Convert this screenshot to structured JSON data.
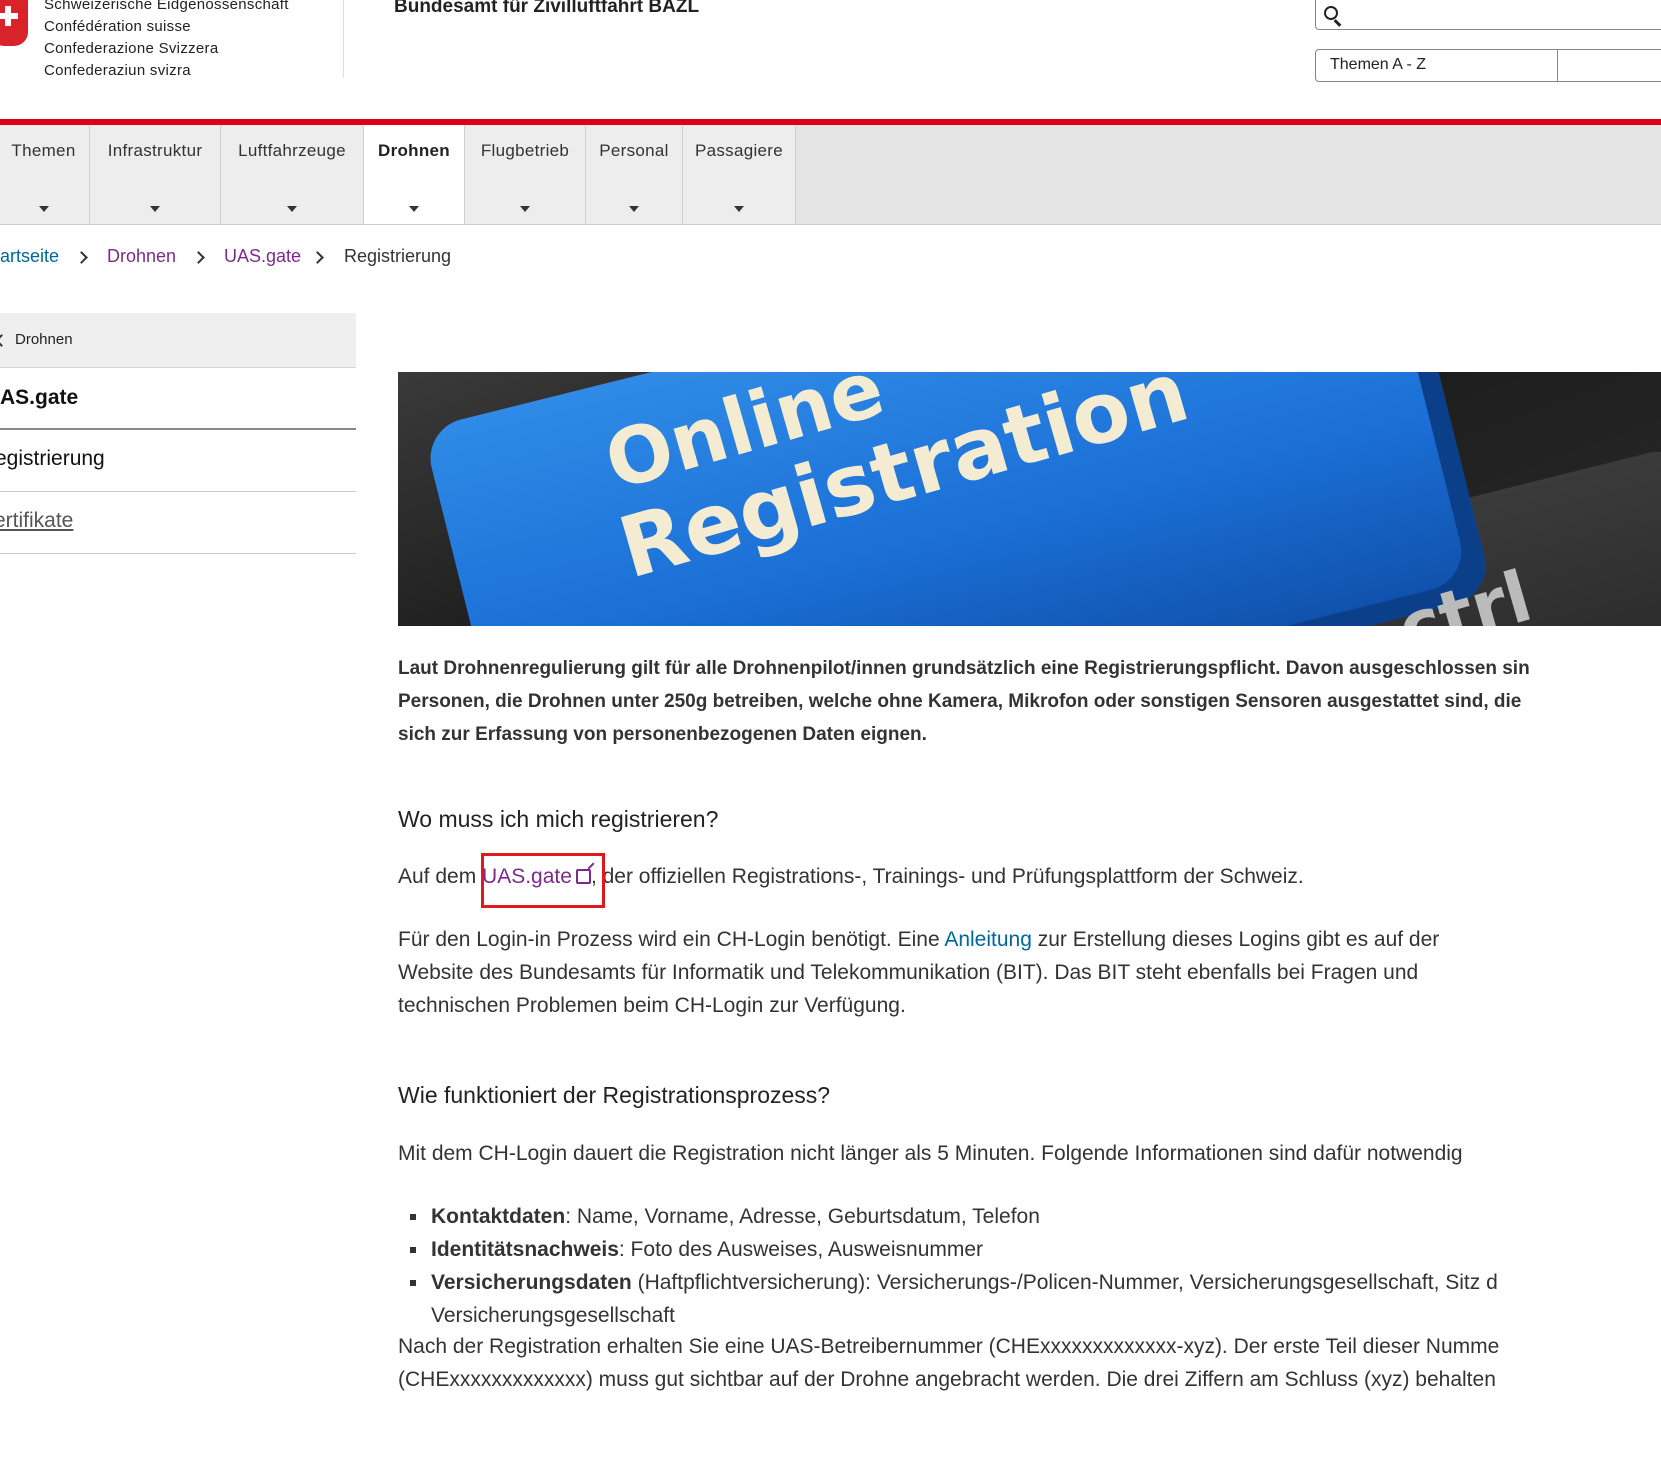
{
  "header": {
    "confederation_names": [
      "Schweizerische Eidgenossenschaft",
      "Confédération suisse",
      "Confederazione Svizzera",
      "Confederaziun svizra"
    ],
    "office_title": "Bundesamt für Zivilluftfahrt BAZL",
    "search": {
      "placeholder": ""
    },
    "themen_az": "Themen A - Z"
  },
  "nav": {
    "items": [
      {
        "label": "Themen",
        "active": false
      },
      {
        "label": "Infrastruktur",
        "active": false
      },
      {
        "label": "Luftfahrzeuge",
        "active": false
      },
      {
        "label": "Drohnen",
        "active": true
      },
      {
        "label": "Flugbetrieb",
        "active": false
      },
      {
        "label": "Personal",
        "active": false
      },
      {
        "label": "Passagiere",
        "active": false
      }
    ]
  },
  "breadcrumb": [
    "artseite",
    "Drohnen",
    "UAS.gate",
    "Registrierung"
  ],
  "sidebar": {
    "back_label": "Drohnen",
    "items": [
      "AS.gate",
      "egistrierung",
      "ertifikate"
    ]
  },
  "hero": {
    "line1": "Online",
    "line2": "Registration",
    "line3": "ctrl"
  },
  "content": {
    "lead": [
      "Laut Drohnenregulierung gilt für alle Drohnenpilot/innen grundsätzlich eine Registrierungspflicht. Davon ausgeschlossen sin",
      "Personen, die Drohnen unter 250g betreiben, welche ohne Kamera, Mikrofon oder sonstigen Sensoren ausgestattet sind, die",
      "sich zur Erfassung von personenbezogenen Daten eignen."
    ],
    "heading1": "Wo muss ich mich registrieren?",
    "p1_before": "Auf dem ",
    "p1_link": "UAS.gate",
    "p1_after": ", der offiziellen Registrations-, Trainings- und Prüfungsplattform der Schweiz.",
    "p2_l1_before": "Für den Login-in Prozess wird ein CH-Login benötigt. Eine ",
    "p2_link": "Anleitung",
    "p2_l1_after": " zur Erstellung dieses Logins gibt es auf der",
    "p2_l2": "Website des Bundesamts für Informatik und Telekommunikation (BIT). Das BIT steht ebenfalls bei Fragen und",
    "p2_l3": "technischen Problemen beim CH-Login zur Verfügung.",
    "heading2": "Wie funktioniert der Registrationsprozess?",
    "p3": "Mit dem CH-Login dauert die Registration nicht länger als 5 Minuten. Folgende Informationen sind dafür notwendig",
    "list": [
      {
        "term": "Kontaktdaten",
        "text": ": Name, Vorname, Adresse, Geburtsdatum, Telefon"
      },
      {
        "term": "Identitätsnachweis",
        "text": ": Foto des Ausweises, Ausweisnummer"
      },
      {
        "term": "Versicherungsdaten",
        "text": " (Haftpflichtversicherung): Versicherungs-/Policen-Nummer, Versicherungsgesellschaft, Sitz d"
      }
    ],
    "list_cont": "Versicherungsgesellschaft",
    "p4_l1": "Nach der Registration erhalten Sie eine UAS-Betreibernummer (CHExxxxxxxxxxxxx-xyz). Der erste Teil dieser Numme",
    "p4_l2": "(CHExxxxxxxxxxxxx) muss gut sichtbar auf der Drohne angebracht werden. Die drei Ziffern am Schluss (xyz) behalten"
  },
  "colors": {
    "swiss_red": "#dc0018",
    "link_purple": "#7a2b8a",
    "link_blue": "#006699",
    "highlight_red": "#e0191f"
  }
}
